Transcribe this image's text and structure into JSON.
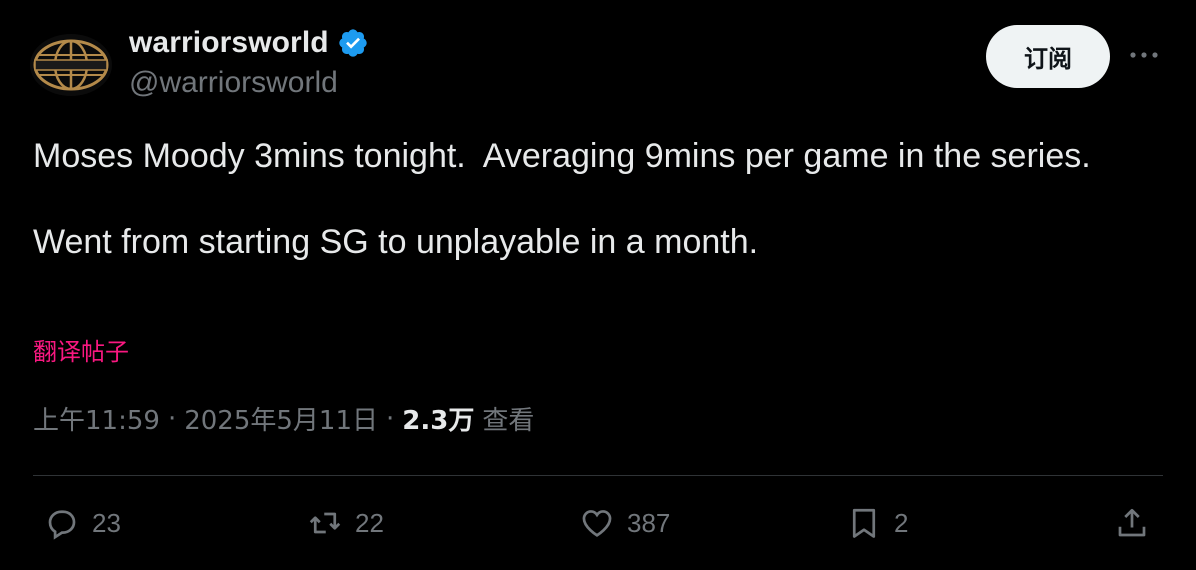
{
  "author": {
    "display_name": "warriorsworld",
    "handle": "@warriorsworld",
    "verified": true,
    "avatar_icon": "globe-logo",
    "verified_color": "#1d9bf0"
  },
  "header": {
    "subscribe_label": "订阅",
    "more_icon": "more-icon"
  },
  "tweet": {
    "text": "Moses Moody 3mins tonight.  Averaging 9mins per game in the series.\n\nWent from starting SG to unplayable in a month.",
    "translate_label": "翻译帖子"
  },
  "meta": {
    "time": "上午11:59",
    "separator": "·",
    "date": "2025年5月11日",
    "views_count": "2.3万",
    "views_label": "查看"
  },
  "actions": {
    "reply": {
      "icon": "reply-icon",
      "count": "23"
    },
    "retweet": {
      "icon": "retweet-icon",
      "count": "22"
    },
    "like": {
      "icon": "heart-icon",
      "count": "387"
    },
    "bookmark": {
      "icon": "bookmark-icon",
      "count": "2"
    },
    "share": {
      "icon": "share-icon"
    }
  },
  "colors": {
    "background": "#000000",
    "text": "#e7e9ea",
    "muted": "#71767b",
    "accent_pink": "#f91880",
    "verified_blue": "#1d9bf0",
    "button_bg": "#eff3f4"
  }
}
